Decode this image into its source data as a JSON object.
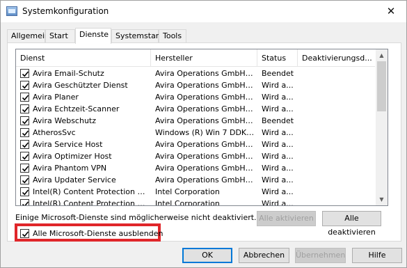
{
  "window": {
    "title": "Systemkonfiguration",
    "close_glyph": "✕",
    "icon": "msconfig-icon"
  },
  "tabs": [
    {
      "label": "Allgemein"
    },
    {
      "label": "Start"
    },
    {
      "label": "Dienste",
      "active": true
    },
    {
      "label": "Systemstart"
    },
    {
      "label": "Tools"
    }
  ],
  "columns": {
    "service": "Dienst",
    "manufacturer": "Hersteller",
    "status": "Status",
    "deactivation": "Deaktivierungsd..."
  },
  "services": [
    {
      "name": "Avira Email-Schutz",
      "manufacturer": "Avira Operations GmbH & ...",
      "status": "Beendet",
      "checked": true
    },
    {
      "name": "Avira Geschützter Dienst",
      "manufacturer": "Avira Operations GmbH & ...",
      "status": "Wird a...",
      "checked": true
    },
    {
      "name": "Avira Planer",
      "manufacturer": "Avira Operations GmbH & ...",
      "status": "Wird a...",
      "checked": true
    },
    {
      "name": "Avira Echtzeit-Scanner",
      "manufacturer": "Avira Operations GmbH & ...",
      "status": "Wird a...",
      "checked": true
    },
    {
      "name": "Avira Webschutz",
      "manufacturer": "Avira Operations GmbH & ...",
      "status": "Beendet",
      "checked": true
    },
    {
      "name": "AtherosSvc",
      "manufacturer": "Windows (R) Win 7 DDK pr...",
      "status": "Wird a...",
      "checked": true
    },
    {
      "name": "Avira Service Host",
      "manufacturer": "Avira Operations GmbH & ...",
      "status": "Wird a...",
      "checked": true
    },
    {
      "name": "Avira Optimizer Host",
      "manufacturer": "Avira Operations GmbH & ...",
      "status": "Wird a...",
      "checked": true
    },
    {
      "name": "Avira Phantom VPN",
      "manufacturer": "Avira Operations GmbH & ...",
      "status": "Wird a...",
      "checked": true
    },
    {
      "name": "Avira Updater Service",
      "manufacturer": "Avira Operations GmbH & ...",
      "status": "Wird a...",
      "checked": true
    },
    {
      "name": "Intel(R) Content Protection HEC...",
      "manufacturer": "Intel Corporation",
      "status": "Wird a...",
      "checked": true
    },
    {
      "name": "Intel(R) Content Protection HDC...",
      "manufacturer": "Intel Corporation",
      "status": "Wird a...",
      "checked": true
    }
  ],
  "note": "Einige Microsoft-Dienste sind möglicherweise nicht deaktiviert.",
  "buttons": {
    "enable_all": "Alle aktivieren",
    "disable_all": "Alle deaktivieren",
    "ok": "OK",
    "cancel": "Abbrechen",
    "apply": "Übernehmen",
    "help": "Hilfe"
  },
  "hide_ms_services": {
    "label": "Alle Microsoft-Dienste ausblenden",
    "checked": true
  },
  "colors": {
    "highlight_border": "#e0262a",
    "default_button_border": "#0078d7"
  }
}
